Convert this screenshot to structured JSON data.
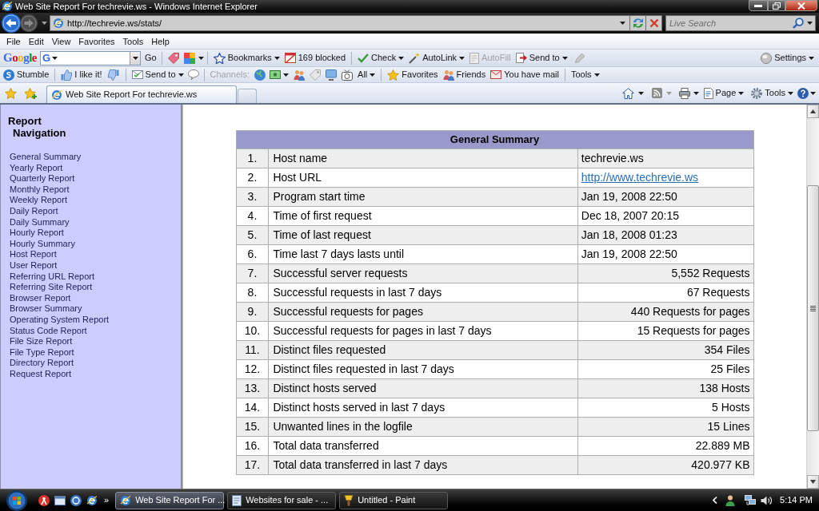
{
  "window": {
    "title": "Web Site Report For techrevie.ws - Windows Internet Explorer"
  },
  "address_bar": {
    "url": "http://techrevie.ws/stats/"
  },
  "search_box": {
    "placeholder": "Live Search"
  },
  "menu_bar": [
    "File",
    "Edit",
    "View",
    "Favorites",
    "Tools",
    "Help"
  ],
  "google_toolbar": {
    "logo": "Google",
    "engine_letter": "G",
    "go_label": "Go",
    "items": [
      {
        "label": "Bookmarks",
        "has_menu": true,
        "disabled": false
      },
      {
        "label": "169 blocked",
        "has_menu": false,
        "disabled": false
      },
      {
        "label": "Check",
        "has_menu": true,
        "disabled": false
      },
      {
        "label": "AutoLink",
        "has_menu": true,
        "disabled": false
      },
      {
        "label": "AutoFill",
        "has_menu": false,
        "disabled": true
      },
      {
        "label": "Send to",
        "has_menu": true,
        "disabled": false
      }
    ],
    "settings": {
      "label": "Settings",
      "has_menu": true
    }
  },
  "stumble_toolbar": {
    "items": [
      {
        "label": "Stumble",
        "has_menu": false,
        "disabled": false
      },
      {
        "label": "I like it!",
        "has_menu": false,
        "disabled": false
      },
      {
        "label": "Send to",
        "has_menu": true,
        "disabled": false
      },
      {
        "label": "Channels:",
        "has_menu": false,
        "disabled": true
      },
      {
        "label": "All",
        "has_menu": true,
        "disabled": false
      },
      {
        "label": "Favorites",
        "has_menu": false,
        "disabled": false
      },
      {
        "label": "Friends",
        "has_menu": false,
        "disabled": false
      },
      {
        "label": "You have mail",
        "has_menu": false,
        "disabled": false
      },
      {
        "label": "Tools",
        "has_menu": true,
        "disabled": false
      }
    ]
  },
  "tabs": [
    {
      "label": "Web Site Report For techrevie.ws",
      "selected": true
    }
  ],
  "command_bar": [
    {
      "label": "Page",
      "has_menu": true
    },
    {
      "label": "Tools",
      "has_menu": true
    }
  ],
  "sidebar": {
    "title": "Report Navigation",
    "items": [
      "General Summary",
      "Yearly Report",
      "Quarterly Report",
      "Monthly Report",
      "Weekly Report",
      "Daily Report",
      "Daily Summary",
      "Hourly Report",
      "Hourly Summary",
      "Host Report",
      "User Report",
      "Referring URL Report",
      "Referring Site Report",
      "Browser Report",
      "Browser Summary",
      "Operating System Report",
      "Status Code Report",
      "File Size Report",
      "File Type Report",
      "Directory Report",
      "Request Report"
    ]
  },
  "table": {
    "title": "General Summary",
    "rows": [
      {
        "number": "1.",
        "label": "Host name",
        "value": "techrevie.ws",
        "kind": "text"
      },
      {
        "number": "2.",
        "label": "Host URL",
        "value": "http://www.techrevie.ws",
        "kind": "link"
      },
      {
        "number": "3.",
        "label": "Program start time",
        "value": "Jan 19, 2008 22:50",
        "kind": "text"
      },
      {
        "number": "4.",
        "label": "Time of first request",
        "value": "Dec 18, 2007 20:15",
        "kind": "text"
      },
      {
        "number": "5.",
        "label": "Time of last request",
        "value": "Jan 18, 2008 01:23",
        "kind": "text"
      },
      {
        "number": "6.",
        "label": "Time last 7 days lasts until",
        "value": "Jan 19, 2008 22:50",
        "kind": "text"
      },
      {
        "number": "7.",
        "label": "Successful server requests",
        "value": "5,552 Requests",
        "kind": "number"
      },
      {
        "number": "8.",
        "label": "Successful requests in last 7 days",
        "value": "67 Requests",
        "kind": "number"
      },
      {
        "number": "9.",
        "label": "Successful requests for pages",
        "value": "440 Requests for pages",
        "kind": "number"
      },
      {
        "number": "10.",
        "label": "Successful requests for pages in last 7 days",
        "value": "15 Requests for pages",
        "kind": "number"
      },
      {
        "number": "11.",
        "label": "Distinct files requested",
        "value": "354 Files",
        "kind": "number"
      },
      {
        "number": "12.",
        "label": "Distinct files requested in last 7 days",
        "value": "25 Files",
        "kind": "number"
      },
      {
        "number": "13.",
        "label": "Distinct hosts served",
        "value": "138 Hosts",
        "kind": "number"
      },
      {
        "number": "14.",
        "label": "Distinct hosts served in last 7 days",
        "value": "5 Hosts",
        "kind": "number"
      },
      {
        "number": "15.",
        "label": "Unwanted lines in the logfile",
        "value": "15 Lines",
        "kind": "number"
      },
      {
        "number": "16.",
        "label": "Total data transferred",
        "value": "22.889 MB",
        "kind": "number"
      },
      {
        "number": "17.",
        "label": "Total data transferred in last 7 days",
        "value": "420.977 KB",
        "kind": "number"
      }
    ]
  },
  "taskbar": {
    "more_label": "»",
    "tasks": [
      {
        "label": "Web Site Report For ...",
        "selected": true
      },
      {
        "label": "Websites for sale - ...",
        "selected": false
      },
      {
        "label": "Untitled - Paint",
        "selected": false
      }
    ],
    "clock": "5:14 PM"
  }
}
